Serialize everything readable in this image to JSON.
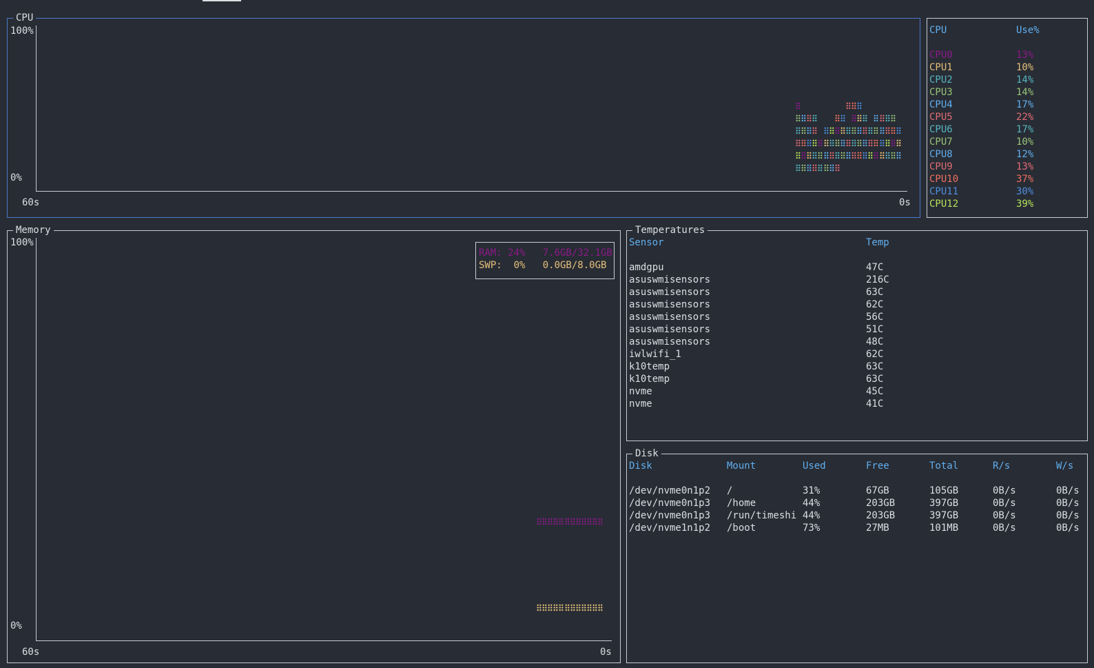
{
  "cpu_panel": {
    "title": "CPU",
    "y_top": "100%",
    "y_bottom": "0%",
    "x_left": "60s",
    "x_right": "0s"
  },
  "cpu_table": {
    "headers": [
      "CPU",
      "Use%"
    ],
    "rows": [
      {
        "name": "CPU0",
        "use": "13%",
        "color": "#8b1a8b"
      },
      {
        "name": "CPU1",
        "use": "10%",
        "color": "#e5c07b"
      },
      {
        "name": "CPU2",
        "use": "14%",
        "color": "#56b6c2"
      },
      {
        "name": "CPU3",
        "use": "14%",
        "color": "#98c379"
      },
      {
        "name": "CPU4",
        "use": "17%",
        "color": "#61afef"
      },
      {
        "name": "CPU5",
        "use": "22%",
        "color": "#e06c75"
      },
      {
        "name": "CPU6",
        "use": "17%",
        "color": "#56b6c2"
      },
      {
        "name": "CPU7",
        "use": "10%",
        "color": "#98c379"
      },
      {
        "name": "CPU8",
        "use": "12%",
        "color": "#61afef"
      },
      {
        "name": "CPU9",
        "use": "13%",
        "color": "#e06c75"
      },
      {
        "name": "CPU10",
        "use": "37%",
        "color": "#f07060"
      },
      {
        "name": "CPU11",
        "use": "30%",
        "color": "#4d8fe0"
      },
      {
        "name": "CPU12",
        "use": "39%",
        "color": "#b5e35a"
      }
    ]
  },
  "memory_panel": {
    "title": "Memory",
    "y_top": "100%",
    "y_bottom": "0%",
    "x_left": "60s",
    "x_right": "0s",
    "ram_label": "RAM: 24%   7.6GB/32.1GB",
    "swp_label": "SWP:  0%   0.0GB/8.0GB",
    "ram_color": "#8b1a8b",
    "swp_color": "#e5c07b"
  },
  "temps": {
    "title": "Temperatures",
    "headers": [
      "Sensor",
      "Temp"
    ],
    "rows": [
      {
        "sensor": "amdgpu",
        "temp": "47C"
      },
      {
        "sensor": "asuswmisensors",
        "temp": "216C"
      },
      {
        "sensor": "asuswmisensors",
        "temp": "63C"
      },
      {
        "sensor": "asuswmisensors",
        "temp": "62C"
      },
      {
        "sensor": "asuswmisensors",
        "temp": "56C"
      },
      {
        "sensor": "asuswmisensors",
        "temp": "51C"
      },
      {
        "sensor": "asuswmisensors",
        "temp": "48C"
      },
      {
        "sensor": "iwlwifi_1",
        "temp": "62C"
      },
      {
        "sensor": "k10temp",
        "temp": "63C"
      },
      {
        "sensor": "k10temp",
        "temp": "63C"
      },
      {
        "sensor": "nvme",
        "temp": "45C"
      },
      {
        "sensor": "nvme",
        "temp": "41C"
      }
    ]
  },
  "disk": {
    "title": "Disk",
    "headers": [
      "Disk",
      "Mount",
      "Used",
      "Free",
      "Total",
      "R/s",
      "W/s"
    ],
    "rows": [
      [
        "/dev/nvme0n1p2",
        "/",
        "31%",
        "67GB",
        "105GB",
        "0B/s",
        "0B/s"
      ],
      [
        "/dev/nvme0n1p3",
        "/home",
        "44%",
        "203GB",
        "397GB",
        "0B/s",
        "0B/s"
      ],
      [
        "/dev/nvme0n1p3",
        "/run/timeshi",
        "44%",
        "203GB",
        "397GB",
        "0B/s",
        "0B/s"
      ],
      [
        "/dev/nvme1n1p2",
        "/boot",
        "73%",
        "27MB",
        "101MB",
        "0B/s",
        "0B/s"
      ]
    ]
  }
}
